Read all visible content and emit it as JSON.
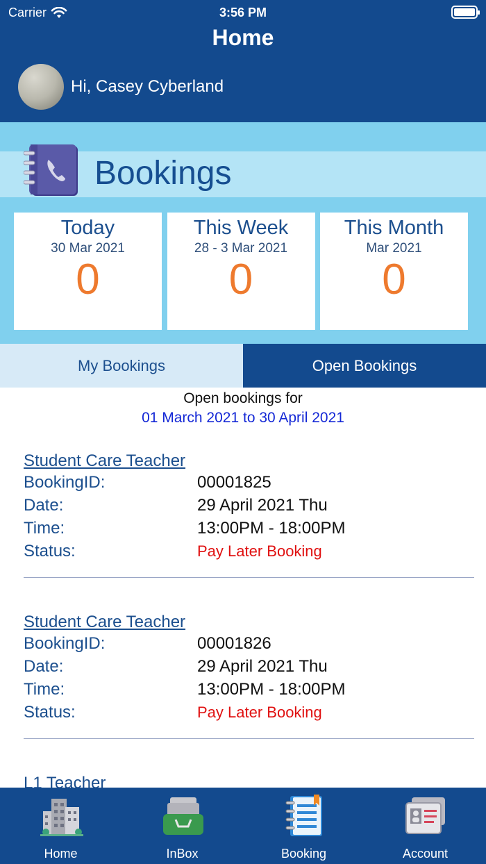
{
  "status_bar": {
    "carrier": "Carrier",
    "time": "3:56 PM"
  },
  "header": {
    "title": "Home",
    "greeting": "Hi, Casey Cyberland"
  },
  "bookings_section": {
    "title": "Bookings",
    "cards": [
      {
        "title": "Today",
        "subtitle": "30 Mar 2021",
        "value": "0"
      },
      {
        "title": "This Week",
        "subtitle": "28 - 3 Mar 2021",
        "value": "0"
      },
      {
        "title": "This Month",
        "subtitle": "Mar 2021",
        "value": "0"
      }
    ]
  },
  "tabs": [
    {
      "label": "My Bookings",
      "active": false
    },
    {
      "label": "Open Bookings",
      "active": true
    }
  ],
  "open_bookings": {
    "range_label": "Open bookings for",
    "range_dates": "01 March 2021 to 30 April 2021",
    "field_labels": {
      "id": "BookingID:",
      "date": "Date:",
      "time": "Time:",
      "status": "Status:"
    },
    "items": [
      {
        "title": "Student Care Teacher",
        "id": "00001825",
        "date": "29 April 2021 Thu",
        "time": "13:00PM - 18:00PM",
        "status": "Pay Later Booking"
      },
      {
        "title": "Student Care Teacher",
        "id": "00001826",
        "date": "29 April 2021 Thu",
        "time": "13:00PM - 18:00PM",
        "status": "Pay Later Booking"
      },
      {
        "title": "L1 Teacher"
      }
    ]
  },
  "tab_bar": [
    {
      "label": "Home",
      "icon": "buildings-icon"
    },
    {
      "label": "InBox",
      "icon": "inbox-tray-icon"
    },
    {
      "label": "Booking",
      "icon": "notebook-icon"
    },
    {
      "label": "Account",
      "icon": "id-card-icon"
    }
  ],
  "colors": {
    "header_blue": "#134a8e",
    "panel_blue": "#80d0ee",
    "count_orange": "#ee7a2e",
    "status_red": "#e01010",
    "range_blue": "#1428d6"
  }
}
